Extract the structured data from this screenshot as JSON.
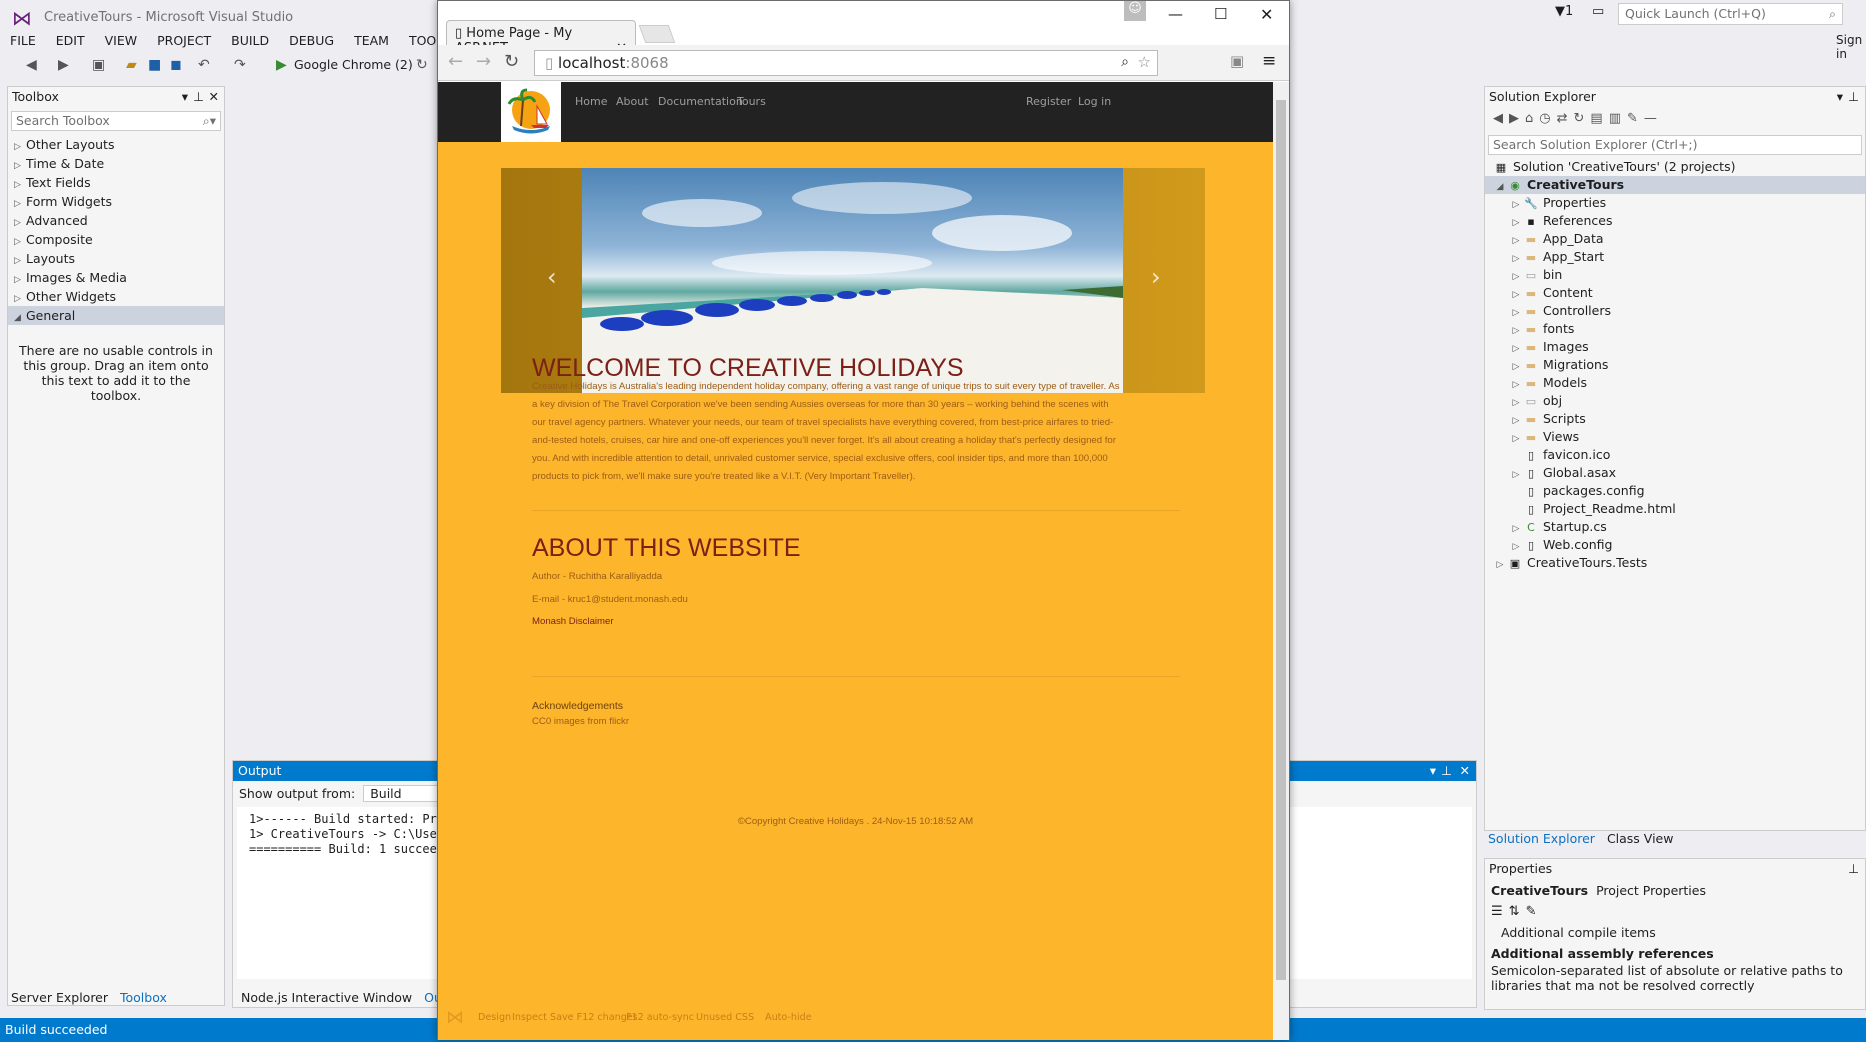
{
  "vs": {
    "title": "CreativeTours - Microsoft Visual Studio",
    "menu": [
      "FILE",
      "EDIT",
      "VIEW",
      "PROJECT",
      "BUILD",
      "DEBUG",
      "TEAM",
      "TOOLS",
      "T"
    ],
    "run_target": "Google Chrome (2)",
    "quick_launch": "Quick Launch (Ctrl+Q)",
    "notifications": "1",
    "signin": "Sign in",
    "status": "Build succeeded"
  },
  "toolbox": {
    "title": "Toolbox",
    "search": "Search Toolbox",
    "items": [
      {
        "label": "Other Layouts",
        "expanded": false
      },
      {
        "label": "Time & Date",
        "expanded": false
      },
      {
        "label": "Text Fields",
        "expanded": false
      },
      {
        "label": "Form Widgets",
        "expanded": false
      },
      {
        "label": "Advanced",
        "expanded": false
      },
      {
        "label": "Composite",
        "expanded": false
      },
      {
        "label": "Layouts",
        "expanded": false
      },
      {
        "label": "Images & Media",
        "expanded": false
      },
      {
        "label": "Other Widgets",
        "expanded": false
      },
      {
        "label": "General",
        "expanded": true
      }
    ],
    "empty_msg": "There are no usable controls in this group. Drag an item onto this text to add it to the toolbox.",
    "tabs": [
      "Server Explorer",
      "Toolbox"
    ]
  },
  "output": {
    "title": "Output",
    "show_from_label": "Show output from:",
    "show_from_value": "Build",
    "lines": [
      "1>------ Build started: Pro",
      "1>  CreativeTours -> C:\\Use",
      "========== Build: 1 succeed"
    ],
    "tabs": [
      "Node.js Interactive Window",
      "Output"
    ]
  },
  "solution_explorer": {
    "title": "Solution Explorer",
    "search": "Search Solution Explorer (Ctrl+;)",
    "solution": "Solution 'CreativeTours' (2 projects)",
    "project": "CreativeTours",
    "items": [
      {
        "label": "Properties",
        "icon": "wrench-icon",
        "expandable": true
      },
      {
        "label": "References",
        "icon": "references-icon",
        "expandable": true
      },
      {
        "label": "App_Data",
        "icon": "folder-icon",
        "expandable": true
      },
      {
        "label": "App_Start",
        "icon": "folder-icon",
        "expandable": true
      },
      {
        "label": "bin",
        "icon": "folder-outline-icon",
        "expandable": true
      },
      {
        "label": "Content",
        "icon": "folder-icon",
        "expandable": true
      },
      {
        "label": "Controllers",
        "icon": "folder-icon",
        "expandable": true
      },
      {
        "label": "fonts",
        "icon": "folder-icon",
        "expandable": true
      },
      {
        "label": "Images",
        "icon": "folder-icon",
        "expandable": true
      },
      {
        "label": "Migrations",
        "icon": "folder-icon",
        "expandable": true
      },
      {
        "label": "Models",
        "icon": "folder-icon",
        "expandable": true
      },
      {
        "label": "obj",
        "icon": "folder-outline-icon",
        "expandable": true
      },
      {
        "label": "Scripts",
        "icon": "folder-icon",
        "expandable": true
      },
      {
        "label": "Views",
        "icon": "folder-icon",
        "expandable": true
      },
      {
        "label": "favicon.ico",
        "icon": "file-icon",
        "expandable": false
      },
      {
        "label": "Global.asax",
        "icon": "file-icon",
        "expandable": true
      },
      {
        "label": "packages.config",
        "icon": "file-icon",
        "expandable": false
      },
      {
        "label": "Project_Readme.html",
        "icon": "file-icon",
        "expandable": false
      },
      {
        "label": "Startup.cs",
        "icon": "csharp-icon",
        "expandable": true
      },
      {
        "label": "Web.config",
        "icon": "file-icon",
        "expandable": true
      }
    ],
    "tests_project": "CreativeTours.Tests",
    "tabs": [
      "Solution Explorer",
      "Class View"
    ]
  },
  "properties": {
    "title": "Properties",
    "object": "CreativeTours",
    "object_type": "Project Properties",
    "row1": "Additional compile items",
    "heading": "Additional assembly references",
    "desc": "Semicolon-separated list of absolute or relative paths to libraries that ma not be resolved correctly"
  },
  "chrome": {
    "tab_title": "Home Page - My ASP.NET",
    "url_host": "localhost",
    "url_port": ":8068"
  },
  "site": {
    "nav": [
      "Home",
      "About",
      "Documentation",
      "Tours"
    ],
    "nav_right": [
      "Register",
      "Log in"
    ],
    "welcome_title": "WELCOME TO CREATIVE HOLIDAYS",
    "welcome_lines": [
      "Creative Holidays is Australia's leading independent holiday company, offering a vast range of unique trips to suit every type of traveller. As",
      "a key division of The Travel Corporation we've been sending Aussies overseas for more than 30 years – working behind the scenes with",
      "our travel agency partners. Whatever your needs, our team of travel specialists have everything covered, from best-price airfares to tried-",
      "and-tested hotels, cruises, car hire and one-off experiences you'll never forget. It's all about creating a holiday that's perfectly designed for",
      "you. And with incredible attention to detail, unrivaled customer service, special exclusive offers, cool insider tips, and more than 100,000",
      "products to pick from, we'll make sure you're treated like a V.I.T. (Very Important Traveller)."
    ],
    "about_title": "ABOUT THIS WEBSITE",
    "author": "Author - Ruchitha Karalliyadda",
    "email": "E-mail - kruc1@student.monash.edu",
    "disclaimer": "Monash Disclaimer",
    "ack_title": "Acknowledgements",
    "ack_text": "CC0 images from flickr",
    "copyright": "©Copyright Creative Holidays . 24-Nov-15 10:18:52 AM",
    "devbar": [
      "Design",
      "Inspect",
      "Save F12 changes",
      "F12 auto-sync",
      "Unused CSS",
      "Auto-hide"
    ]
  }
}
